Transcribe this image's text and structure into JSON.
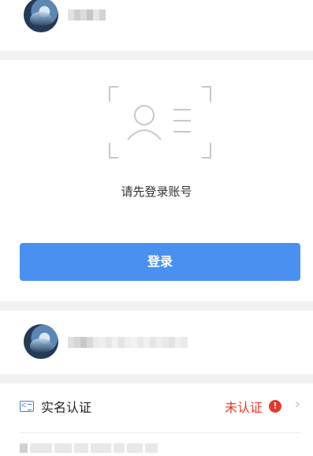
{
  "login": {
    "prompt": "请先登录账号",
    "button_label": "登录"
  },
  "verification": {
    "label": "实名认证",
    "status": "未认证",
    "warning_glyph": "!",
    "chevron": "›",
    "status_color": "#e7392d"
  },
  "colors": {
    "accent": "#4a90f0",
    "divider": "#f2f2f5",
    "text": "#333333"
  },
  "icons": [
    "avatar",
    "scan-face-icon",
    "id-card-icon",
    "warning-icon",
    "chevron-right-icon"
  ]
}
